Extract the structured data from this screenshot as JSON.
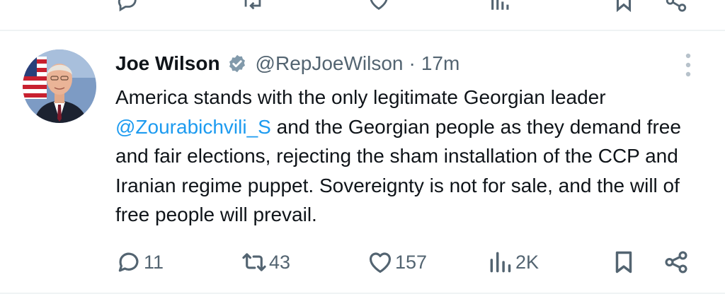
{
  "previous_tweet": {
    "reply_icon": "reply-icon",
    "repost_icon": "repost-icon",
    "like_icon": "like-icon",
    "views_icon": "views-icon",
    "bookmark_icon": "bookmark-icon",
    "share_icon": "share-icon"
  },
  "tweet": {
    "author": {
      "name": "Joe Wilson",
      "verified": true,
      "handle": "@RepJoeWilson",
      "separator": "·",
      "time": "17m"
    },
    "text": {
      "part1": "America stands with the only legitimate Georgian leader ",
      "mention": "@Zourabichvili_S",
      "part2": " and the Georgian people as they demand free and fair elections, rejecting the sham installation of the CCP and Iranian regime puppet. Sovereignty is not for sale, and the will of free people will prevail."
    },
    "actions": {
      "replies": "11",
      "reposts": "43",
      "likes": "157",
      "views": "2K"
    }
  },
  "colors": {
    "text": "#0f1419",
    "secondary": "#536471",
    "link": "#1d9bf0",
    "divider": "#eff3f4",
    "verified_badge": "#829aab"
  }
}
